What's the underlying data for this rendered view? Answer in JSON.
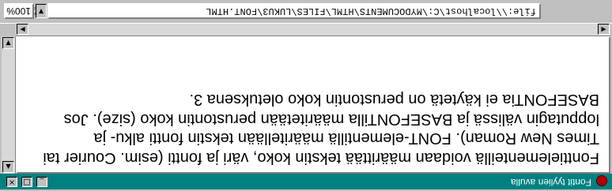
{
  "window": {
    "title": "Fontit tyylien avulla",
    "minimize": "_",
    "maximize": "□",
    "close": "×"
  },
  "content": {
    "paragraph": "Fonttielementeillä voidaan määrittää tekstin koko, väri ja fontti (esim. Courier tai Times New Roman). FONT-elementillä määritellään tekstin fontti alku- ja lopputagin välissä ja BASEFONTilla määritetään perustontin koko (size). Jos BASEFONTia ei käytetä on perustontin koko oletuksena 3."
  },
  "toolbar": {
    "address": "file:\\\\localhost\\C:\\MYDOCUMENTS\\HTML\\FILES\\LUKU3\\FONT.HTML",
    "zoom": "100%",
    "icons": [
      "back-icon",
      "print-icon",
      "green-status-icon"
    ]
  },
  "colors": {
    "titlebar": "#008080",
    "window_bg": "#c0c0c0",
    "content_bg": "#ffffff"
  }
}
